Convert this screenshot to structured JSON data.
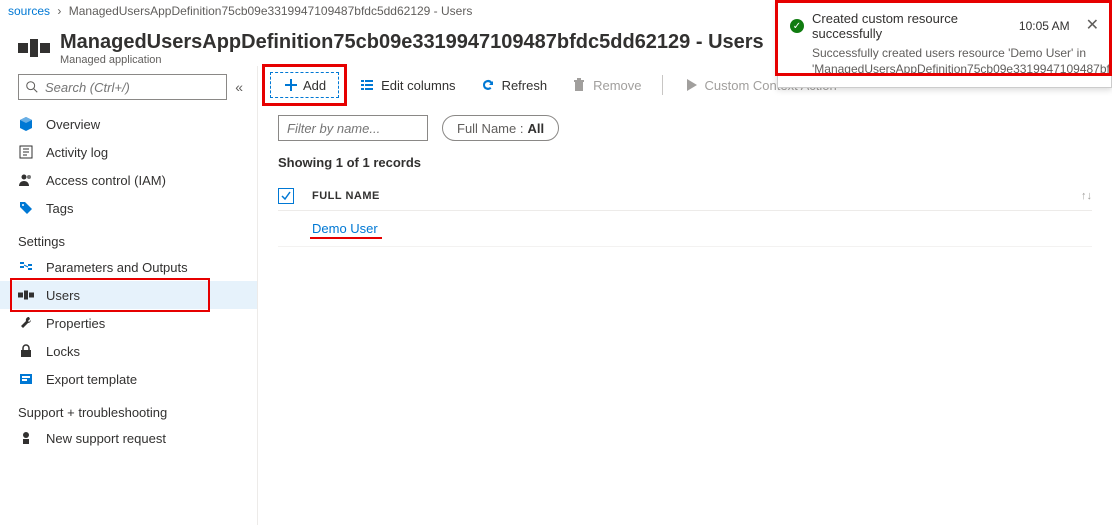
{
  "breadcrumb": {
    "prev": "sources",
    "current": "ManagedUsersAppDefinition75cb09e3319947109487bfdc5dd62129 - Users"
  },
  "header": {
    "title": "ManagedUsersAppDefinition75cb09e3319947109487bfdc5dd62129 - Users",
    "subtitle": "Managed application"
  },
  "search": {
    "placeholder": "Search (Ctrl+/)"
  },
  "nav": {
    "overview": "Overview",
    "activity": "Activity log",
    "iam": "Access control (IAM)",
    "tags": "Tags",
    "settings": "Settings",
    "params": "Parameters and Outputs",
    "users": "Users",
    "properties": "Properties",
    "locks": "Locks",
    "export": "Export template",
    "support": "Support + troubleshooting",
    "newreq": "New support request"
  },
  "toolbar": {
    "add": "Add",
    "columns": "Edit columns",
    "refresh": "Refresh",
    "remove": "Remove",
    "custom": "Custom Context Action"
  },
  "filter": {
    "placeholder": "Filter by name...",
    "pill_label": "Full Name : ",
    "pill_value": "All"
  },
  "records_text": "Showing 1 of 1 records",
  "table": {
    "header": "FULL NAME",
    "rows": [
      {
        "name": "Demo User"
      }
    ]
  },
  "toast": {
    "title": "Created custom resource successfully",
    "time": "10:05 AM",
    "body": "Successfully created users resource 'Demo User' in 'ManagedUsersAppDefinition75cb09e3319947109487bf..."
  }
}
